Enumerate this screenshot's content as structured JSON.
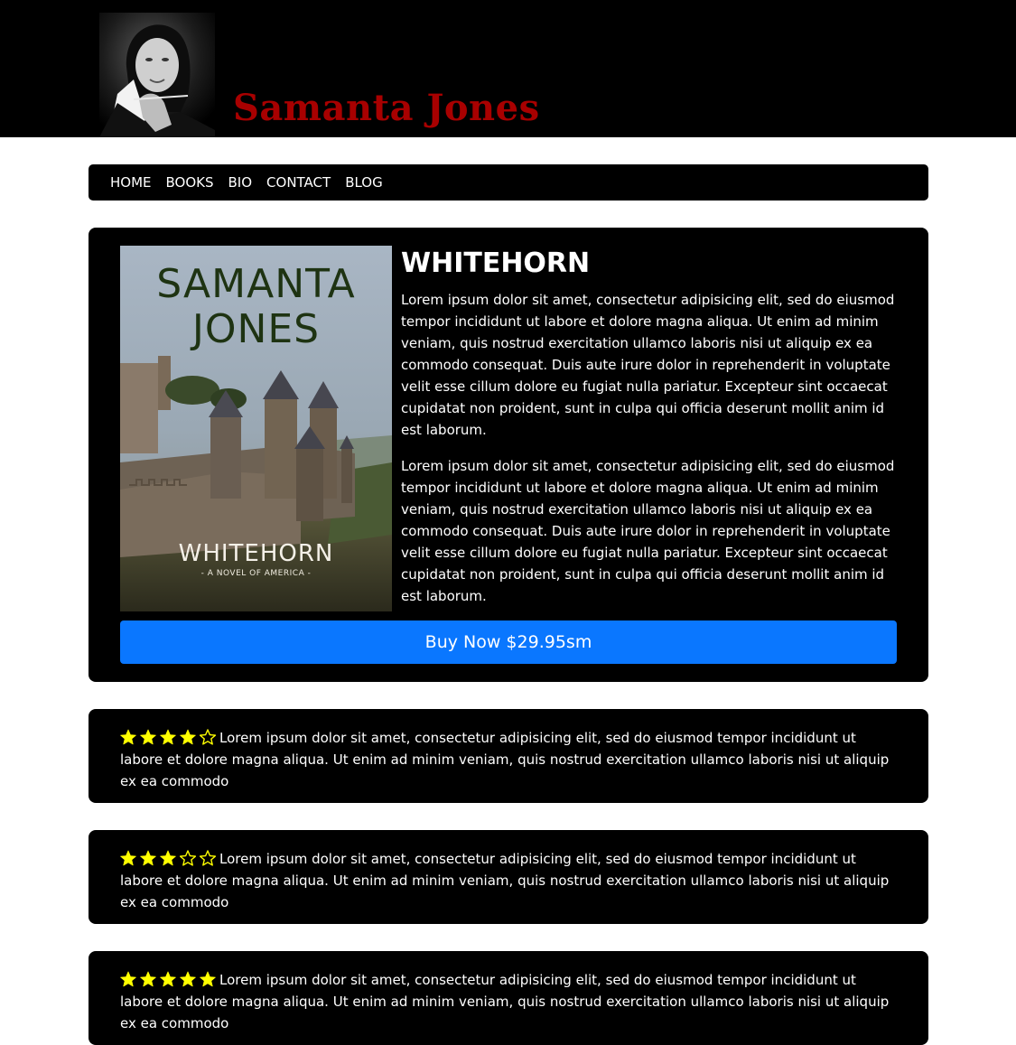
{
  "header": {
    "site_title": "Samanta Jones"
  },
  "nav": {
    "items": [
      "HOME",
      "BOOKS",
      "BIO",
      "CONTACT",
      "BLOG"
    ]
  },
  "book": {
    "cover": {
      "author": [
        "SAMANTA",
        "JONES"
      ],
      "title": "WHITEHORN",
      "subtitle": "- A NOVEL OF AMERICA -"
    },
    "title": "WHITEHORN",
    "paragraphs": [
      "Lorem ipsum dolor sit amet, consectetur adipisicing elit, sed do eiusmod tempor incididunt ut labore et dolore magna aliqua. Ut enim ad minim veniam, quis nostrud exercitation ullamco laboris nisi ut aliquip ex ea commodo consequat. Duis aute irure dolor in reprehenderit in voluptate velit esse cillum dolore eu fugiat nulla pariatur. Excepteur sint occaecat cupidatat non proident, sunt in culpa qui officia deserunt mollit anim id est laborum.",
      "Lorem ipsum dolor sit amet, consectetur adipisicing elit, sed do eiusmod tempor incididunt ut labore et dolore magna aliqua. Ut enim ad minim veniam, quis nostrud exercitation ullamco laboris nisi ut aliquip ex ea commodo consequat. Duis aute irure dolor in reprehenderit in voluptate velit esse cillum dolore eu fugiat nulla pariatur. Excepteur sint occaecat cupidatat non proident, sunt in culpa qui officia deserunt mollit anim id est laborum."
    ],
    "buy_label": "Buy Now $29.95sm"
  },
  "reviews": [
    {
      "rating": 4,
      "max": 5,
      "text": "Lorem ipsum dolor sit amet, consectetur adipisicing elit, sed do eiusmod tempor incididunt ut labore et dolore magna aliqua. Ut enim ad minim veniam, quis nostrud exercitation ullamco laboris nisi ut aliquip ex ea commodo"
    },
    {
      "rating": 3,
      "max": 5,
      "text": "Lorem ipsum dolor sit amet, consectetur adipisicing elit, sed do eiusmod tempor incididunt ut labore et dolore magna aliqua. Ut enim ad minim veniam, quis nostrud exercitation ullamco laboris nisi ut aliquip ex ea commodo"
    },
    {
      "rating": 5,
      "max": 5,
      "text": "Lorem ipsum dolor sit amet, consectetur adipisicing elit, sed do eiusmod tempor incididunt ut labore et dolore magna aliqua. Ut enim ad minim veniam, quis nostrud exercitation ullamco laboris nisi ut aliquip ex ea commodo"
    }
  ],
  "colors": {
    "star": "#ffff00",
    "title_red": "#a80000",
    "button_blue": "#0a77ff"
  },
  "icons": {
    "star_filled": "star-filled-icon",
    "star_empty": "star-outline-icon"
  }
}
